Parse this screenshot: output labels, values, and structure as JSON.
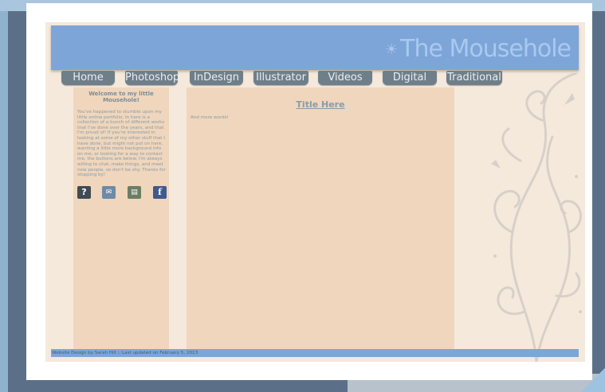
{
  "site": {
    "logo_text": "The Mousehole",
    "nav": [
      "Home",
      "Photoshop",
      "InDesign",
      "Illustrator",
      "Videos",
      "Digital",
      "Traditional"
    ]
  },
  "sidebar": {
    "title": "Welcome to my little Mousehole!",
    "body": "You've happened to stumble upon my little online portfolio. In here is a collection of a bunch of different works that I've done over the years, and that I'm proud of! If you're interested in looking at some of my other stuff that I have done, but might not put on here, wanting a little more background info on me, or looking for a way to contact me, the buttons are below. I'm always willing to chat, make things, and meet new people, so don't be shy. Thanks for stopping by!",
    "icons": [
      "help-icon",
      "mail-icon",
      "gallery-icon",
      "facebook-icon"
    ]
  },
  "content": {
    "title": "Title Here",
    "text": "And more words!"
  },
  "footer": {
    "text": "Website Design by Sarah Hill :: Last updated on February 5, 2013"
  },
  "colors": {
    "header": "#7ea5d8",
    "page_bg": "#f5e9dc",
    "panel": "#efd6bc",
    "nav_button": "#6f7f8a",
    "text": "#8a9ba9"
  }
}
